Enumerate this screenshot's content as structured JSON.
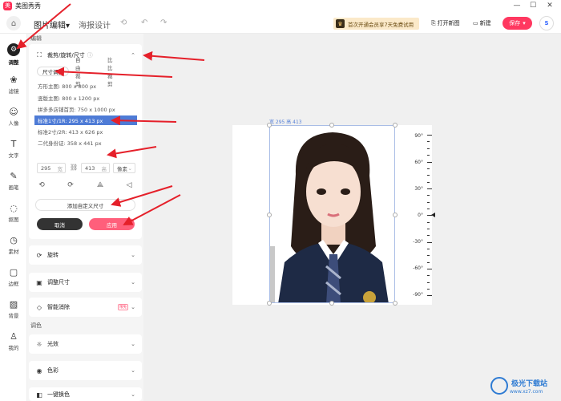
{
  "app": {
    "title": "美图秀秀",
    "logo_char": "美"
  },
  "window_controls": [
    "—",
    "☐",
    "✕"
  ],
  "toolbar": {
    "tabs": [
      {
        "label": "图片编辑",
        "active": true
      },
      {
        "label": "海报设计",
        "active": false
      }
    ],
    "tab_chevron": "▾",
    "history_icons": [
      "⟲",
      "↶",
      "↷"
    ],
    "promo_text": "首次开通会员享7天免费试用",
    "promo_icon": "♛",
    "open_new_label": "打开新图",
    "new_label": "新建",
    "save_label": "保存",
    "save_chevron": "▾",
    "open_icon": "⎘",
    "new_icon": "▭",
    "avatar_text": "S"
  },
  "rail": {
    "items": [
      {
        "label": "调整",
        "icon": "⚙",
        "active": true
      },
      {
        "label": "滤镜",
        "icon": "❀"
      },
      {
        "label": "人像",
        "icon": "☺"
      },
      {
        "label": "文字",
        "icon": "T"
      },
      {
        "label": "画笔",
        "icon": "✎"
      },
      {
        "label": "抠图",
        "icon": "◌"
      },
      {
        "label": "素材",
        "icon": "◷"
      },
      {
        "label": "边框",
        "icon": "▢"
      },
      {
        "label": "背景",
        "icon": "▨"
      },
      {
        "label": "我的",
        "icon": "♙"
      }
    ]
  },
  "panel": {
    "heading": "编辑",
    "crop_section": {
      "title": "裁剪/旋转/尺寸",
      "info_icon": "ⓘ",
      "subtabs": [
        {
          "label": "尺寸调整",
          "active": true
        },
        {
          "label": "自由裁剪",
          "active": false
        },
        {
          "label": "比比裁剪",
          "active": false
        }
      ],
      "presets": [
        {
          "label": "方形主图: 800 x 800 px",
          "active": false
        },
        {
          "label": "竖版主图: 800 x 1200 px",
          "active": false
        },
        {
          "label": "拼多多店铺首页: 750 x 1000 px",
          "active": false
        },
        {
          "label": "标准1寸/1R: 295 x 413 px",
          "active": true
        },
        {
          "label": "标准2寸/2R: 413 x 626 px",
          "active": false
        },
        {
          "label": "二代身份证: 358 x 441 px",
          "active": false
        }
      ],
      "width_value": "295",
      "width_unit": "宽",
      "height_value": "413",
      "height_unit": "高",
      "unit_select": "像素",
      "link_icon": "🔗",
      "transform_icons": [
        "⟲",
        "⟳",
        "⟁",
        "◁"
      ],
      "custom_size_label": "添加自定义尺寸",
      "cancel_label": "取消",
      "apply_label": "应用"
    },
    "sections": [
      {
        "title": "旋转",
        "icon": "⟳"
      },
      {
        "title": "调整尺寸",
        "icon": "▣"
      },
      {
        "title": "智能消除",
        "icon": "◇",
        "badge": "限免"
      }
    ],
    "color_heading": "调色",
    "color_sections": [
      {
        "title": "光效",
        "icon": "☼"
      },
      {
        "title": "色彩",
        "icon": "◉"
      },
      {
        "title": "一键换色",
        "icon": "◧"
      }
    ]
  },
  "canvas": {
    "dimension_label": "宽 295 高 413",
    "ruler_labels": [
      "90°",
      "60°",
      "30°",
      "0°",
      "-30°",
      "-60°",
      "-90°"
    ]
  },
  "watermark": {
    "title": "极光下载站",
    "sub": "www.xz7.com"
  },
  "colors": {
    "accent_pink": "#ff3860",
    "selection_blue": "#4e7bd6",
    "annotation_red": "#e5202a"
  }
}
